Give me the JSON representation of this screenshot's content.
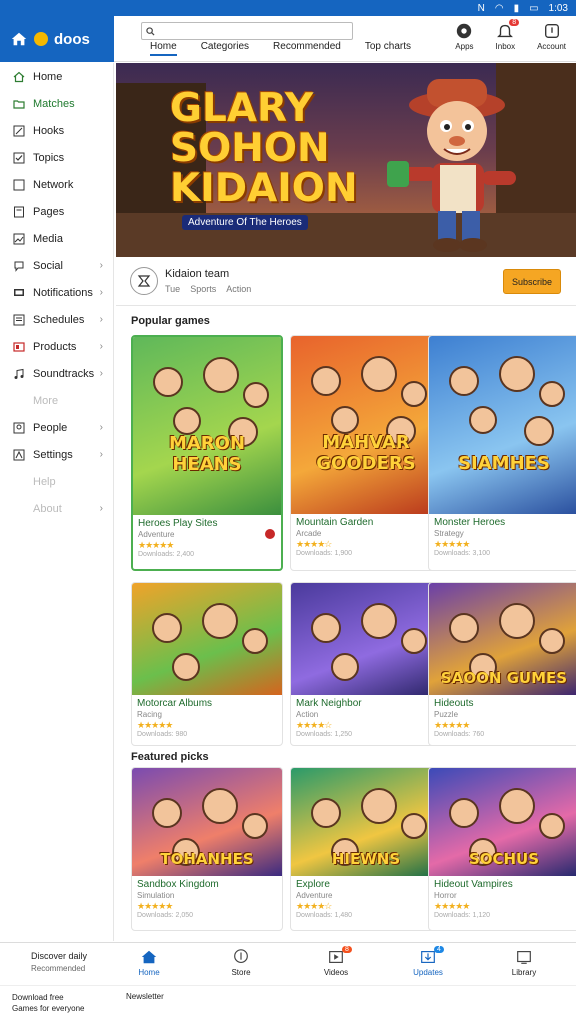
{
  "status_bar": {
    "time": "1:03",
    "icons": [
      "nfc-icon",
      "wifi-icon",
      "signal-icon",
      "battery-icon"
    ]
  },
  "brand": {
    "name": "doos"
  },
  "search": {
    "placeholder": ""
  },
  "nav_tabs": [
    {
      "label": "Home",
      "active": true
    },
    {
      "label": "Categories",
      "active": false
    },
    {
      "label": "Recommended",
      "active": false
    },
    {
      "label": "Top charts",
      "active": false
    }
  ],
  "top_actions": [
    {
      "label": "Apps",
      "icon": "apps-icon",
      "badge": ""
    },
    {
      "label": "Inbox",
      "icon": "bell-icon",
      "badge": "8"
    },
    {
      "label": "Account",
      "icon": "user-icon",
      "badge": ""
    }
  ],
  "sidebar": {
    "items": [
      {
        "label": "Home",
        "icon": "home-icon",
        "chevron": false,
        "state": "normal"
      },
      {
        "label": "Matches",
        "icon": "folder-icon",
        "chevron": false,
        "state": "active"
      },
      {
        "label": "Hooks",
        "icon": "edit-icon",
        "chevron": false,
        "state": "normal"
      },
      {
        "label": "Topics",
        "icon": "check-square-icon",
        "chevron": false,
        "state": "normal"
      },
      {
        "label": "Network",
        "icon": "square-icon",
        "chevron": false,
        "state": "normal"
      },
      {
        "label": "Pages",
        "icon": "page-icon",
        "chevron": false,
        "state": "normal"
      },
      {
        "label": "Media",
        "icon": "image-icon",
        "chevron": false,
        "state": "normal"
      },
      {
        "label": "Social",
        "icon": "chat-icon",
        "chevron": true,
        "state": "normal"
      },
      {
        "label": "Notifications",
        "icon": "monitor-icon",
        "chevron": true,
        "state": "normal"
      },
      {
        "label": "Schedules",
        "icon": "list-icon",
        "chevron": true,
        "state": "normal"
      },
      {
        "label": "Products",
        "icon": "tag-icon",
        "chevron": true,
        "state": "normal"
      },
      {
        "label": "Soundtracks",
        "icon": "music-icon",
        "chevron": true,
        "state": "normal"
      },
      {
        "label": "More",
        "icon": "",
        "chevron": false,
        "state": "muted"
      },
      {
        "label": "People",
        "icon": "people-icon",
        "chevron": true,
        "state": "normal"
      },
      {
        "label": "Settings",
        "icon": "gear-icon",
        "chevron": true,
        "state": "normal"
      },
      {
        "label": "Help",
        "icon": "",
        "chevron": false,
        "state": "muted"
      },
      {
        "label": "About",
        "icon": "",
        "chevron": true,
        "state": "muted"
      }
    ]
  },
  "hero": {
    "title_lines": [
      "GLARY",
      "SOHON",
      "KIDAION"
    ],
    "subtitle": "Adventure Of The Heroes"
  },
  "info": {
    "name": "Kidaion team",
    "meta": [
      "Tue",
      "Sports",
      "Action"
    ],
    "cta_label": "Subscribe"
  },
  "sections": [
    {
      "title": "Popular games"
    },
    {
      "title": "Featured picks"
    }
  ],
  "cards": [
    {
      "art_title": "MARON HEANS",
      "title": "Heroes Play Sites",
      "subtitle": "Adventure",
      "stars": "★★★★★",
      "meta": "Downloads: 2,400",
      "theme": "green"
    },
    {
      "art_title": "MAHVAR GOODERS",
      "title": "Mountain Garden",
      "subtitle": "Arcade",
      "stars": "★★★★☆",
      "meta": "Downloads: 1,900",
      "theme": "orange"
    },
    {
      "art_title": "SIAMHES",
      "title": "Monster Heroes",
      "subtitle": "Strategy",
      "stars": "★★★★★",
      "meta": "Downloads: 3,100",
      "theme": "blue"
    },
    {
      "art_title": "",
      "title": "Motorcar Albums",
      "subtitle": "Racing",
      "stars": "★★★★★",
      "meta": "Downloads: 980",
      "theme": "yellow"
    },
    {
      "art_title": "",
      "title": "Mark Neighbor",
      "subtitle": "Action",
      "stars": "★★★★☆",
      "meta": "Downloads: 1,250",
      "theme": "purple"
    },
    {
      "art_title": "SAOON GUMES",
      "title": "Hideouts",
      "subtitle": "Puzzle",
      "stars": "★★★★★",
      "meta": "Downloads: 760",
      "theme": "violet"
    },
    {
      "art_title": "TOHANHES",
      "title": "Sandbox Kingdom",
      "subtitle": "Simulation",
      "stars": "★★★★★",
      "meta": "Downloads: 2,050",
      "theme": "pink"
    },
    {
      "art_title": "HIEWNS",
      "title": "Explore",
      "subtitle": "Adventure",
      "stars": "★★★★☆",
      "meta": "Downloads: 1,480",
      "theme": "teal"
    },
    {
      "art_title": "SOCHUS",
      "title": "Hideout Vampires",
      "subtitle": "Horror",
      "stars": "★★★★★",
      "meta": "Downloads: 1,120",
      "theme": "indigo"
    }
  ],
  "bottom_nav": {
    "left_line1": "Discover daily",
    "left_line2": "Recommended",
    "items": [
      {
        "label": "Home",
        "icon": "home-icon",
        "badge": "",
        "badge_color": "",
        "active": true
      },
      {
        "label": "Store",
        "icon": "store-icon",
        "badge": "",
        "badge_color": "",
        "active": false
      },
      {
        "label": "Videos",
        "icon": "video-icon",
        "badge": "8",
        "badge_color": "#f4511e",
        "active": false
      },
      {
        "label": "Updates",
        "icon": "download-icon",
        "badge": "4",
        "badge_color": "#1e88e5",
        "active": true
      },
      {
        "label": "Library",
        "icon": "library-icon",
        "badge": "",
        "badge_color": "",
        "active": false
      }
    ]
  },
  "footer": {
    "line1": "Download free",
    "line2": "Games for everyone",
    "note": "Newsletter"
  },
  "colors": {
    "primary": "#1565c0",
    "accent": "#f5a623",
    "title_green": "#1f6b2d",
    "star": "#f2b01e"
  }
}
